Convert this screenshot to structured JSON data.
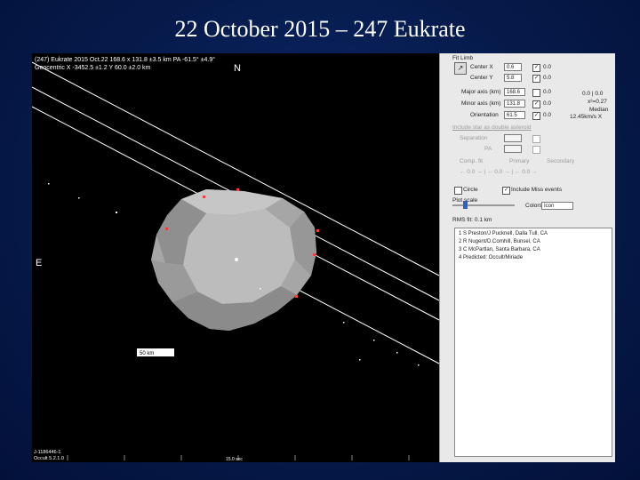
{
  "slide": {
    "title": "22 October 2015 – 247 Eukrate"
  },
  "plot": {
    "header_line1": "(247) Eukrate 2015 Oct.22  168.6 x 131.8 ±3.5 km  PA -61.5° ±4.9°",
    "header_line2": "Geocentric X -3452.5 ±1.2 Y 60.0 ±2.0 km",
    "north_label": "N",
    "east_label": "E",
    "scale_label": "50 km",
    "footer_line1": "J-1186446-1",
    "footer_line2": "Occult 5.2.1.0",
    "bottom_tick_label": "15.0 sec"
  },
  "panel": {
    "fit_header": "Fit Limb",
    "center_x_label": "Center X",
    "center_x_value": "0.6",
    "center_x_step": "0.0",
    "center_y_label": "Center Y",
    "center_y_value": "5.8",
    "center_y_step": "0.0",
    "major_label": "Major axis (km)",
    "major_value": "168.6",
    "major_step": "0.0",
    "minor_label": "Minor axis (km)",
    "minor_value": "131.8",
    "minor_step": "0.0",
    "orient_label": "Orientation",
    "orient_value": "61.5",
    "orient_step": "0.0",
    "side_stat1": "0.0 | 0.0",
    "side_stat2": "x²=0.27",
    "side_median": "Median",
    "side_median_val": "12.45km/s X",
    "grey_link": "Include star as double asteroid",
    "sep_label": "Separation",
    "pa_label": "PA",
    "cmp_label": "Comp. fit",
    "primary_label": "Primary",
    "secondary_label": "Secondary",
    "circle_label": "Circle",
    "include_miss_label": "Include Miss events",
    "plot_scale_label": "Plot scale",
    "colors_label": "Colors",
    "colors_value": "Icon",
    "rms_label": "RMS fit: 0.1 km",
    "observers": [
      "1    S Preston/J Pucknell, Dalla Tull, CA",
      "2    R Nugent/D.Cornhill, Bunsel, CA",
      "3    C McPartlan, Santa Barbara, CA",
      "4    Predicted: Occult/Miriade"
    ]
  }
}
